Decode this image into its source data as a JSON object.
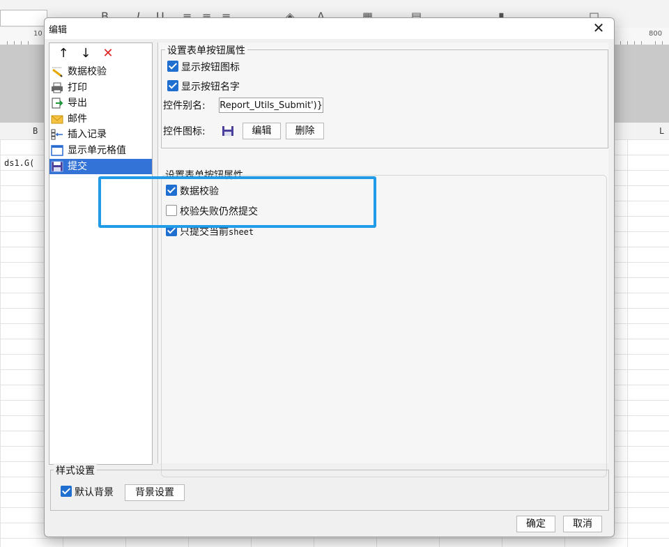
{
  "background": {
    "ruler_numbers": [
      "10",
      "800"
    ],
    "column_headers": [
      "B",
      "L"
    ],
    "cell_text": "ds1.G("
  },
  "dialog": {
    "title": "编辑",
    "close_glyph": "✕",
    "toolbar": {
      "up_glyph": "↑",
      "down_glyph": "↓",
      "delete_glyph": "✕",
      "delete_color": "#e02020"
    },
    "tree": [
      {
        "label": "数据校验",
        "icon": "pencil-icon"
      },
      {
        "label": "打印",
        "icon": "printer-icon"
      },
      {
        "label": "导出",
        "icon": "export-icon"
      },
      {
        "label": "邮件",
        "icon": "mail-icon"
      },
      {
        "label": "插入记录",
        "icon": "insert-row-icon"
      },
      {
        "label": "显示单元格值",
        "icon": "cell-icon"
      },
      {
        "label": "提交",
        "icon": "save-icon",
        "selected": true
      }
    ],
    "group1": {
      "title": "设置表单按钮属性",
      "show_icon_label": "显示按钮图标",
      "show_icon_checked": true,
      "show_name_label": "显示按钮名字",
      "show_name_checked": true,
      "alias_label": "控件别名:",
      "alias_value": "Report_Utils_Submit')}",
      "icon_label": "控件图标:",
      "edit_button": "编辑",
      "delete_button": "删除"
    },
    "group2": {
      "title": "设置表单按钮属性",
      "validate_label": "数据校验",
      "validate_checked": true,
      "submit_on_fail_label": "校验失败仍然提交",
      "submit_on_fail_checked": false,
      "only_current_prefix": "只提交当前",
      "only_current_suffix": "sheet",
      "only_current_checked": true
    },
    "style": {
      "title": "样式设置",
      "default_bg_label": "默认背景",
      "default_bg_checked": true,
      "bg_settings_button": "背景设置"
    },
    "ok_button": "确定",
    "cancel_button": "取消",
    "highlight_color": "#1f9be8",
    "accent_color": "#3373d8"
  }
}
